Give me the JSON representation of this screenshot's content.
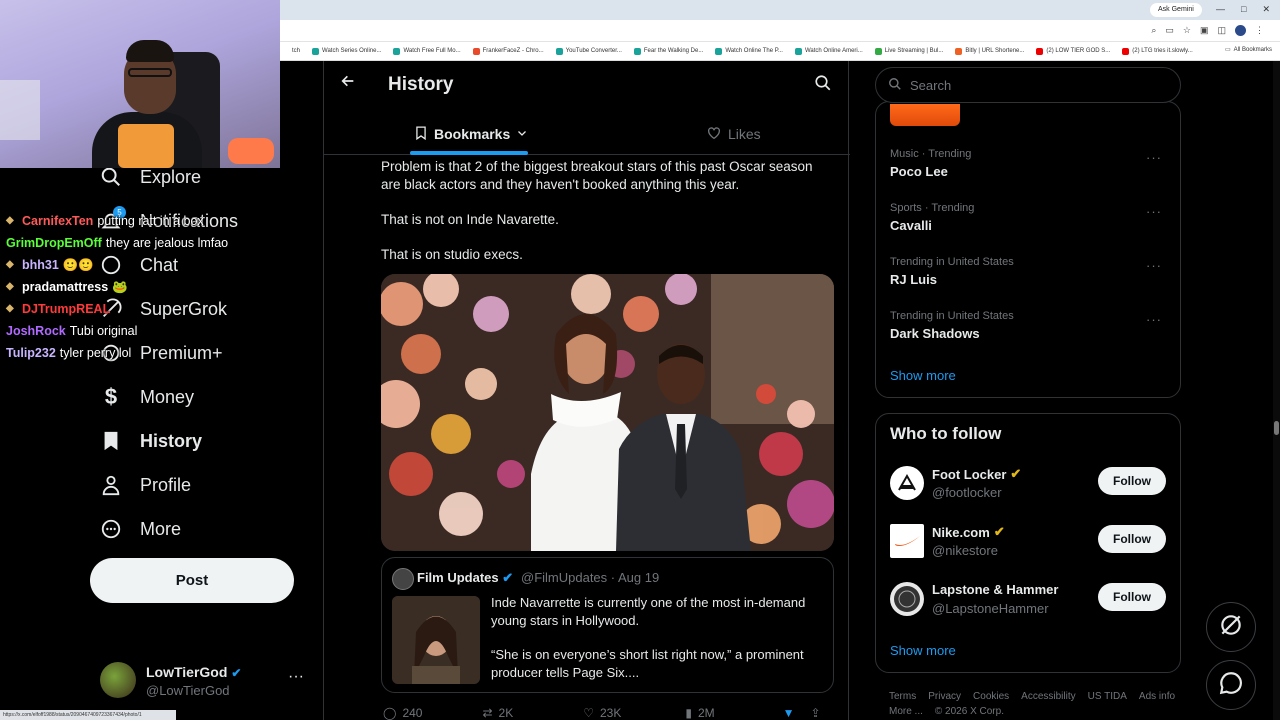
{
  "browser": {
    "ask_gemini": "Ask Gemini",
    "window_controls": [
      "—",
      "□",
      "✕"
    ],
    "bookmarks": [
      {
        "label": "tch",
        "color": "#888"
      },
      {
        "label": "Watch Series Online...",
        "color": "#1aa39a"
      },
      {
        "label": "Watch Free Full Mo...",
        "color": "#1aa39a"
      },
      {
        "label": "FrankerFaceZ - Chro...",
        "color": "#e84a2a"
      },
      {
        "label": "YouTube Converter...",
        "color": "#1aa39a"
      },
      {
        "label": "Fear the Walking De...",
        "color": "#1aa39a"
      },
      {
        "label": "Watch Online The P...",
        "color": "#1aa39a"
      },
      {
        "label": "Watch Online Ameri...",
        "color": "#1aa39a"
      },
      {
        "label": "Live Streaming | Bul...",
        "color": "#33aa44"
      },
      {
        "label": "Bitly | URL Shortene...",
        "color": "#ee6123"
      },
      {
        "label": "(2) LOW TIER GOD S...",
        "color": "#e00"
      },
      {
        "label": "(2) LTG tries it.slowly...",
        "color": "#e00"
      }
    ],
    "all_bookmarks": "All Bookmarks",
    "status_url": "https://x.com/elfoff1988/status/2090467409723367434/photo/1"
  },
  "nav": {
    "explore": "Explore",
    "notifications": "Notifications",
    "notif_badge": "5",
    "chat": "Chat",
    "supergrok": "SuperGrok",
    "premium": "Premium+",
    "money": "Money",
    "history": "History",
    "profile": "Profile",
    "more": "More",
    "post": "Post"
  },
  "chat_overlay": [
    {
      "user": "CarnifexTen",
      "color": "#ff5a5a",
      "msg": "putting ratt in a box",
      "badge": true
    },
    {
      "user": "GrimDropEmOff",
      "color": "#5aff3a",
      "msg": "they are jealous lmfao",
      "badge": false
    },
    {
      "user": "bhh31",
      "color": "#c9b5ff",
      "msg": "",
      "badge": true
    },
    {
      "user": "pradamattress",
      "color": "#ffffff",
      "msg": "",
      "badge": true
    },
    {
      "user": "DJTrumpREAL",
      "color": "#ff3a3a",
      "msg": "",
      "badge": true
    },
    {
      "user": "JoshRock",
      "color": "#b06aff",
      "msg": "Tubi original",
      "badge": false
    },
    {
      "user": "Tulip232",
      "color": "#c9b5ff",
      "msg": "tyler perry lol",
      "badge": false
    }
  ],
  "me": {
    "name": "LowTierGod",
    "handle": "@LowTierGod",
    "more": "···"
  },
  "header": {
    "title": "History"
  },
  "tabs": {
    "bookmarks": "Bookmarks",
    "likes": "Likes"
  },
  "post": {
    "paragraphs": [
      "Problem is that 2 of the biggest breakout stars of this past Oscar season are black actors and they haven't booked anything this year.",
      "That is not on Inde Navarette.",
      "That is on studio execs."
    ],
    "quote": {
      "name": "Film Updates",
      "handle": "@FilmUpdates",
      "date": "Aug 19",
      "meta": "@FilmUpdates · Aug 19",
      "text1": "Inde Navarrette is currently one of the most in-demand young stars in Hollywood.",
      "text2": "“She is on everyone’s short list right now,” a prominent producer tells Page Six...."
    },
    "stats": {
      "replies": "240",
      "reposts": "2K",
      "likes": "23K",
      "views": "2M"
    }
  },
  "sidebar": {
    "search_placeholder": "Search",
    "trends": [
      {
        "category": "Music · Trending",
        "name": "Poco Lee"
      },
      {
        "category": "Sports · Trending",
        "name": "Cavalli"
      },
      {
        "category": "Trending in United States",
        "name": "RJ Luis"
      },
      {
        "category": "Trending in United States",
        "name": "Dark Shadows"
      }
    ],
    "show_more": "Show more",
    "who_to_follow": "Who to follow",
    "follow": [
      {
        "name": "Foot Locker",
        "handle": "@footlocker",
        "button": "Follow"
      },
      {
        "name": "Nike.com",
        "handle": "@nikestore",
        "button": "Follow"
      },
      {
        "name": "Lapstone & Hammer",
        "handle": "@LapstoneHammer",
        "button": "Follow"
      }
    ],
    "footer": [
      "Terms",
      "Privacy",
      "Cookies",
      "Accessibility",
      "US TIDA",
      "Ads info",
      "More ...",
      "© 2026 X Corp."
    ]
  },
  "colors": {
    "accent": "#1d9bf0",
    "verified_gold": "#e2b719"
  }
}
